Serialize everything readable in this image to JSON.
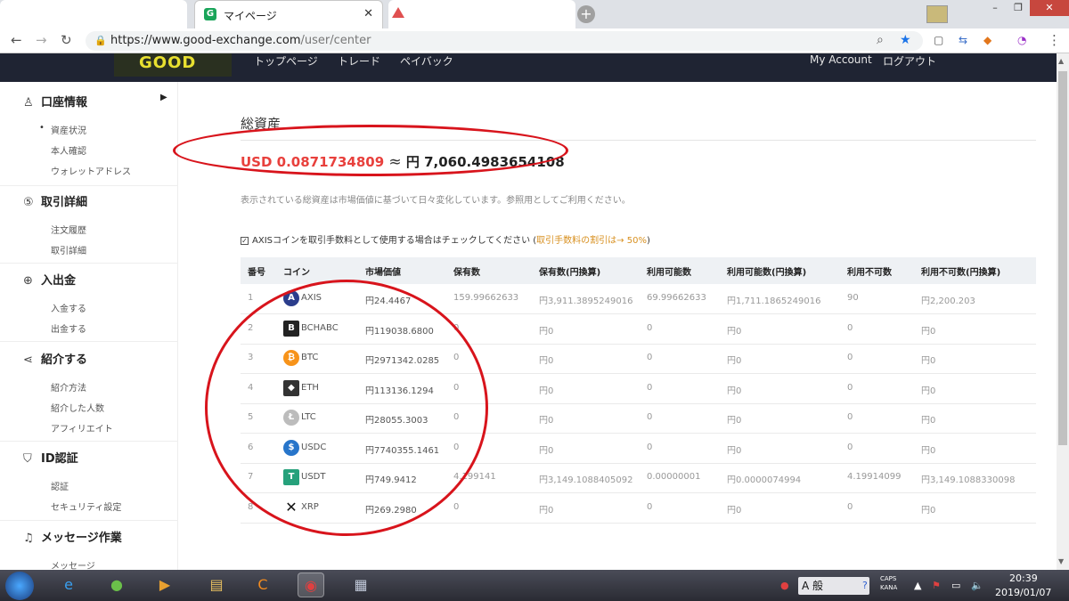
{
  "browser": {
    "active_tab_title": "マイページ",
    "url_host": "https://www.good-exchange.com",
    "url_path": "/user/center"
  },
  "site": {
    "logo": "GOOD",
    "nav": [
      "トップページ",
      "トレード",
      "ペイバック"
    ],
    "account": "My Account",
    "logout": "ログアウト"
  },
  "sidebar": {
    "sections": [
      {
        "label": "口座情報",
        "icon": "user-icon",
        "items": [
          "資産状況",
          "本人確認",
          "ウォレットアドレス"
        ]
      },
      {
        "label": "取引詳細",
        "icon": "exchange-icon",
        "items": [
          "注文履歴",
          "取引詳細"
        ]
      },
      {
        "label": "入出金",
        "icon": "deposit-icon",
        "items": [
          "入金する",
          "出金する"
        ]
      },
      {
        "label": "紹介する",
        "icon": "share-icon",
        "items": [
          "紹介方法",
          "紹介した人数",
          "アフィリエイト"
        ]
      },
      {
        "label": "ID認証",
        "icon": "shield-icon",
        "items": [
          "認証",
          "セキュリティ設定"
        ]
      },
      {
        "label": "メッセージ作業",
        "icon": "bell-icon",
        "items": [
          "メッセージ"
        ]
      }
    ]
  },
  "main": {
    "title": "総資産",
    "total_usd": "USD 0.0871734809",
    "approx": "≈",
    "total_jpy": "円 7,060.4983654108",
    "note": "表示されている総資産は市場価値に基づいて日々変化しています。参照用としてご利用ください。",
    "checkbox_label": "AXISコインを取引手数料として使用する場合はチェックしてください (",
    "checkbox_highlight": "取引手数料の割引は→ 50%",
    "checkbox_close": ")",
    "columns": [
      "番号",
      "コイン",
      "市場価値",
      "保有数",
      "保有数(円換算)",
      "利用可能数",
      "利用可能数(円換算)",
      "利用不可数",
      "利用不可数(円換算)"
    ],
    "rows": [
      [
        "1",
        "AXIS",
        "円24.4467",
        "159.99662633",
        "円3,911.3895249016",
        "69.99662633",
        "円1,711.1865249016",
        "90",
        "円2,200.203"
      ],
      [
        "2",
        "BCHABC",
        "円119038.6800",
        "0",
        "円0",
        "0",
        "円0",
        "0",
        "円0"
      ],
      [
        "3",
        "BTC",
        "円2971342.0285",
        "0",
        "円0",
        "0",
        "円0",
        "0",
        "円0"
      ],
      [
        "4",
        "ETH",
        "円113136.1294",
        "0",
        "円0",
        "0",
        "円0",
        "0",
        "円0"
      ],
      [
        "5",
        "LTC",
        "円28055.3003",
        "0",
        "円0",
        "0",
        "円0",
        "0",
        "円0"
      ],
      [
        "6",
        "USDC",
        "円7740355.1461",
        "0",
        "円0",
        "0",
        "円0",
        "0",
        "円0"
      ],
      [
        "7",
        "USDT",
        "円749.9412",
        "4.199141",
        "円3,149.1088405092",
        "0.00000001",
        "円0.0000074994",
        "4.19914099",
        "円3,149.1088330098"
      ],
      [
        "8",
        "XRP",
        "円269.2980",
        "0",
        "円0",
        "0",
        "円0",
        "0",
        "円0"
      ]
    ],
    "coin_colors": {
      "AXIS": "#2b3d8c",
      "BCHABC": "#222222",
      "BTC": "#f7931a",
      "ETH": "#333333",
      "LTC": "#bcbcbc",
      "USDC": "#2775ca",
      "USDT": "#26a17b",
      "XRP": "#222222"
    }
  },
  "taskbar": {
    "ime": "A 般",
    "caps": "CAPS",
    "kana": "KANA",
    "time": "20:39",
    "date": "2019/01/07"
  },
  "colors": {
    "accent_red": "#e8403c",
    "annotation": "#d8141c",
    "highlight": "#d89020",
    "nav_bg": "#1f2433"
  }
}
